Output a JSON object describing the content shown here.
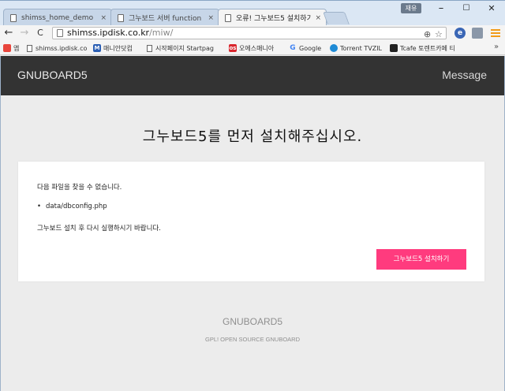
{
  "browser": {
    "tabs": [
      {
        "label": "shimss_home_demo",
        "close": "×"
      },
      {
        "label": "그누보드 서버 function",
        "close": "×"
      },
      {
        "label": "오류! 그누보드5 설치하기",
        "close": "×"
      }
    ],
    "user_badge": "재유",
    "window": {
      "minimize": "–",
      "maximize": "☐",
      "close": "✕"
    },
    "nav": {
      "back": "←",
      "forward": "→",
      "reload": "C"
    },
    "address": {
      "host": "shimss.ipdisk.co.kr",
      "path": "/miw/"
    },
    "omni_icons": {
      "zoom": "⊕",
      "star": "☆"
    },
    "bookmarks": [
      {
        "label": "앱",
        "icon": "apps-icon",
        "color": "#e8453c"
      },
      {
        "label": "shimss.ipdisk.co",
        "icon": "page-icon",
        "color": ""
      },
      {
        "label": "매니안닷컴",
        "icon": "maniaan-icon",
        "color": "#2b5fb4"
      },
      {
        "label": "시작페이지 Startpag",
        "icon": "page-icon",
        "color": ""
      },
      {
        "label": "오에스매니아",
        "icon": "osmania-icon",
        "color": "#d9272e"
      },
      {
        "label": "Google",
        "icon": "google-icon",
        "color": "#4285f4"
      },
      {
        "label": "Torrent TVZIL",
        "icon": "torrent-icon",
        "color": "#1f8bd6"
      },
      {
        "label": "Tcafe 토렌트카페 티",
        "icon": "tcafe-icon",
        "color": "#222222"
      }
    ],
    "bookmarks_more": "»"
  },
  "site": {
    "logo": "GNUBOARD5",
    "header_link": "Message",
    "title": "그누보드5를 먼저 설치해주십시오.",
    "message": {
      "line1": "다음 파일을 찾을 수 없습니다.",
      "files": [
        "data/dbconfig.php"
      ],
      "line2": "그누보드 설치 후 다시 실행하시기 바랍니다."
    },
    "install_button": "그누보드5 설치하기",
    "footer_logo": "GNUBOARD5",
    "footer_copy": "GPL! OPEN SOURCE GNUBOARD"
  },
  "colors": {
    "header_bg": "#333333",
    "page_bg": "#ececec",
    "accent_button": "#ff3b7e"
  }
}
